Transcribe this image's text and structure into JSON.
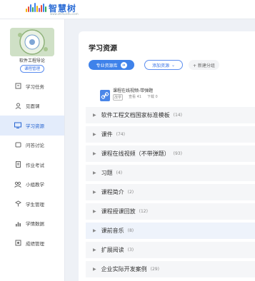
{
  "header": {
    "logo_text": "智慧树",
    "logo_sub": "www.zhihuishu.com",
    "brand_color": "#2f6fd6"
  },
  "sidebar": {
    "course_name": "软件工程导论",
    "course_button": "课程管理",
    "items": [
      {
        "label": "学习任务",
        "icon": "task-icon",
        "active": false
      },
      {
        "label": "见面课",
        "icon": "user-icon",
        "active": false
      },
      {
        "label": "学习资源",
        "icon": "resource-icon",
        "active": true
      },
      {
        "label": "问答讨论",
        "icon": "chat-icon",
        "active": false
      },
      {
        "label": "作业考试",
        "icon": "exam-icon",
        "active": false
      },
      {
        "label": "小组教学",
        "icon": "group-icon",
        "active": false
      },
      {
        "label": "学生管理",
        "icon": "students-icon",
        "active": false
      },
      {
        "label": "学情数据",
        "icon": "data-icon",
        "active": false
      },
      {
        "label": "成绩管理",
        "icon": "grade-icon",
        "active": false
      }
    ]
  },
  "main": {
    "title": "学习资源",
    "toolbar": {
      "library_button": "专业资源库",
      "add_button": "添加资源",
      "new_group_button": "+ 新建分组"
    },
    "file": {
      "title": "课程在线视频-带弹题",
      "tag": "改学",
      "views": "查看 41",
      "downloads": "下载 0"
    },
    "folders": [
      {
        "name": "软件工程文档国家标准模板",
        "count": "(14)"
      },
      {
        "name": "课件",
        "count": "(74)"
      },
      {
        "name": "课程在线视频（不带弹题）",
        "count": "(93)"
      },
      {
        "name": "习题",
        "count": "(4)"
      },
      {
        "name": "课程简介",
        "count": "(2)"
      },
      {
        "name": "课程授课回放",
        "count": "(12)"
      },
      {
        "name": "课前音乐",
        "count": "(8)"
      },
      {
        "name": "扩展阅读",
        "count": "(3)"
      },
      {
        "name": "企业实际开发案例",
        "count": "(29)"
      }
    ]
  }
}
